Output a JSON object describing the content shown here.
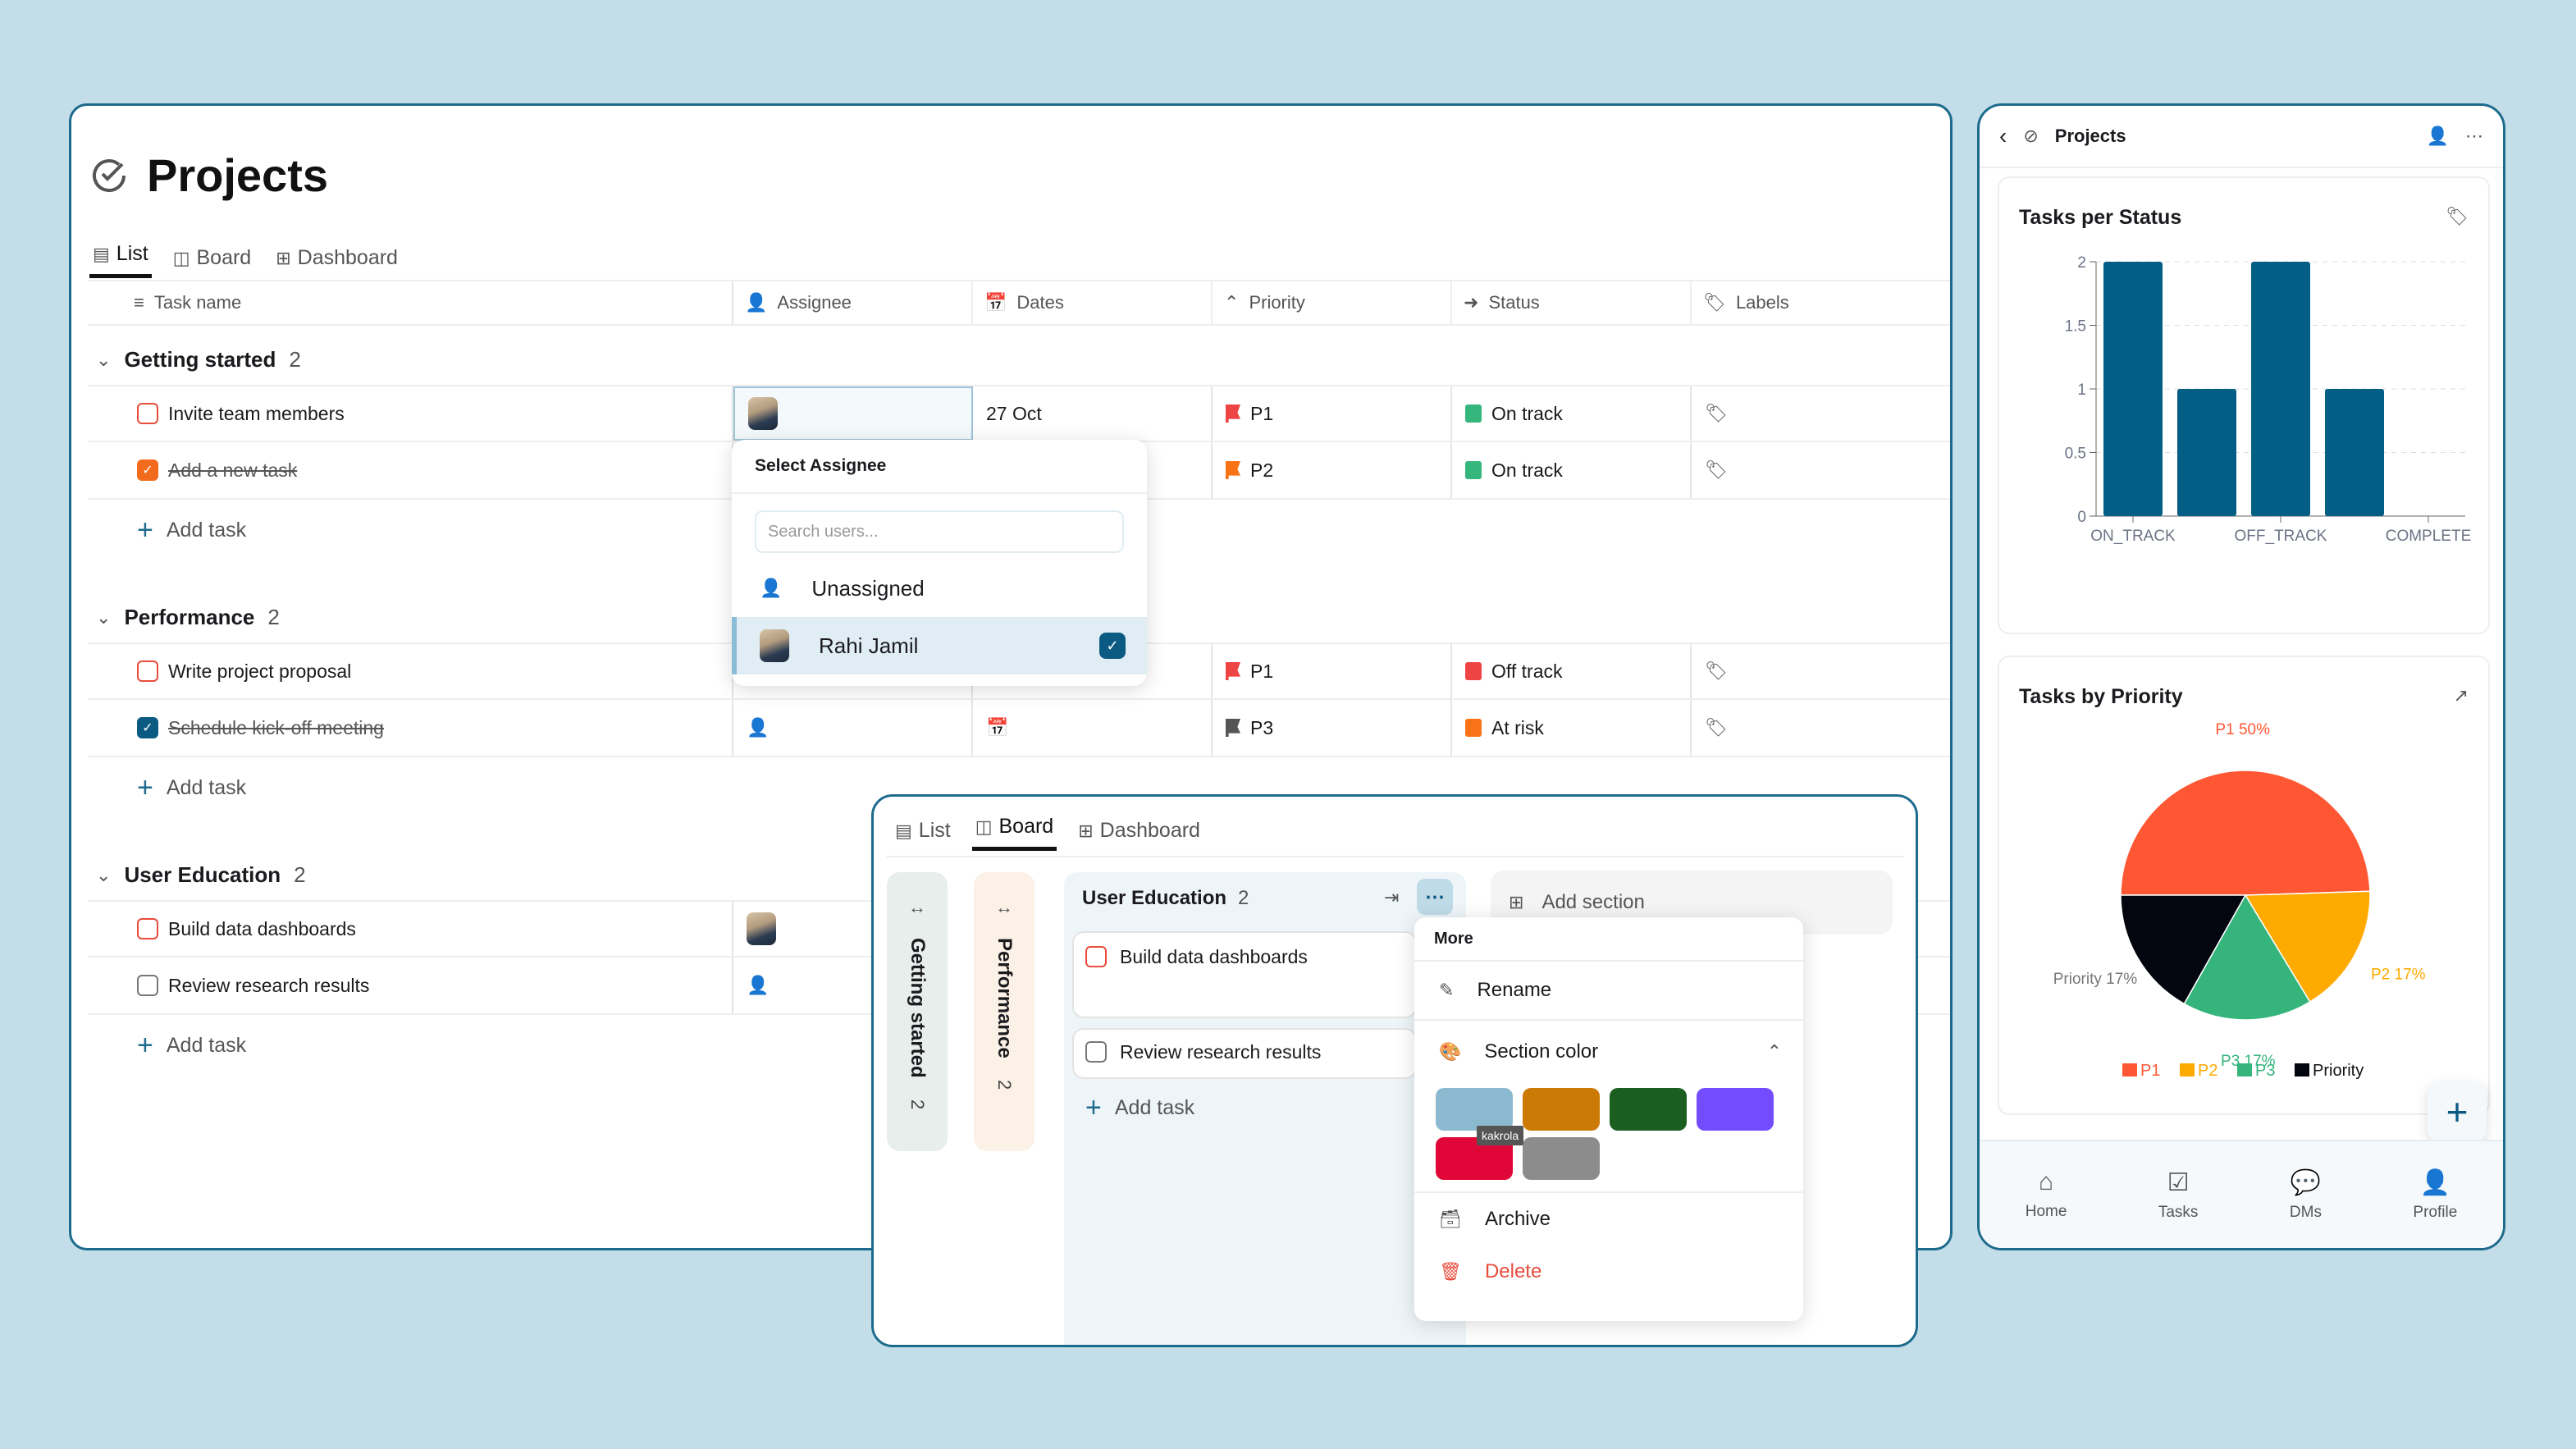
{
  "desktop": {
    "title": "Projects",
    "tabs": [
      {
        "label": "List"
      },
      {
        "label": "Board"
      },
      {
        "label": "Dashboard"
      }
    ],
    "columns": [
      "Task name",
      "Assignee",
      "Dates",
      "Priority",
      "Status",
      "Labels"
    ],
    "sections": [
      {
        "name": "Getting started",
        "count": "2",
        "tasks": [
          {
            "name": "Invite team members",
            "done": false,
            "assignee": "Rahi Jamil",
            "date": "27 Oct",
            "priority": "P1",
            "status": "On track"
          },
          {
            "name": "Add a new task",
            "done": true,
            "assignee": "",
            "date": "",
            "priority": "P2",
            "status": "On track"
          }
        ]
      },
      {
        "name": "Performance",
        "count": "2",
        "tasks": [
          {
            "name": "Write project proposal",
            "done": false,
            "assignee": "",
            "date": "",
            "priority": "P1",
            "status": "Off track"
          },
          {
            "name": "Schedule kick-off meeting",
            "done": true,
            "assignee": "",
            "date": "",
            "priority": "P3",
            "status": "At risk"
          }
        ]
      },
      {
        "name": "User Education",
        "count": "2",
        "tasks": [
          {
            "name": "Build data dashboards",
            "done": false,
            "assignee": "Rahi Jamil"
          },
          {
            "name": "Review research results",
            "done": false,
            "assignee": ""
          }
        ]
      }
    ],
    "add_task_label": "Add task",
    "assignee_popup": {
      "title": "Select Assignee",
      "search_placeholder": "Search users...",
      "options": [
        {
          "label": "Unassigned",
          "selected": false
        },
        {
          "label": "Rahi Jamil",
          "selected": true
        }
      ]
    }
  },
  "board": {
    "tabs": [
      {
        "label": "List"
      },
      {
        "label": "Board"
      },
      {
        "label": "Dashboard"
      }
    ],
    "active_tab": "Board",
    "collapsed_columns": [
      {
        "name": "Getting started",
        "count": "2"
      },
      {
        "name": "Performance",
        "count": "2"
      }
    ],
    "column": {
      "name": "User Education",
      "count": "2",
      "cards": [
        "Build data dashboards",
        "Review research results"
      ]
    },
    "add_task_label": "Add task",
    "add_section_label": "Add section",
    "more_menu": {
      "title": "More",
      "rename": "Rename",
      "section_color": "Section color",
      "colors": [
        "#8bbad0",
        "#cc7a06",
        "#1a5e20",
        "#744cff",
        "#e00637",
        "#8c8c8c"
      ],
      "tooltip": "kakrola",
      "archive": "Archive",
      "delete": "Delete"
    }
  },
  "mobile": {
    "title": "Projects",
    "nav": [
      {
        "label": "Home"
      },
      {
        "label": "Tasks"
      },
      {
        "label": "DMs"
      },
      {
        "label": "Profile"
      }
    ]
  },
  "colors": {
    "accent": "#0a5a82",
    "p1": "#ef4444",
    "p2": "#f97316",
    "p3": "#555555",
    "on_track": "#34b67d",
    "off_track": "#ef4444",
    "at_risk": "#f97316"
  },
  "chart_data": [
    {
      "type": "bar",
      "title": "Tasks per Status",
      "categories": [
        "ON_TRACK",
        "",
        "OFF_TRACK",
        "",
        "COMPLETE"
      ],
      "values": [
        2,
        1,
        2,
        1,
        0
      ],
      "yticks": [
        "0",
        "0.5",
        "1",
        "1.5",
        "2"
      ],
      "ylim": [
        0,
        2
      ],
      "grid": true,
      "color": "#035e86"
    },
    {
      "type": "pie",
      "title": "Tasks by Priority",
      "labels": [
        "P1",
        "P2",
        "P3",
        "Priority"
      ],
      "values": [
        50,
        17,
        17,
        17
      ],
      "data_labels": [
        "P1 50%",
        "P2 17%",
        "P3 17%",
        "Priority 17%"
      ],
      "colors": [
        "#ff5733",
        "#ffaa00",
        "#35b57c",
        "#04060f"
      ],
      "legend": "bottom"
    }
  ]
}
